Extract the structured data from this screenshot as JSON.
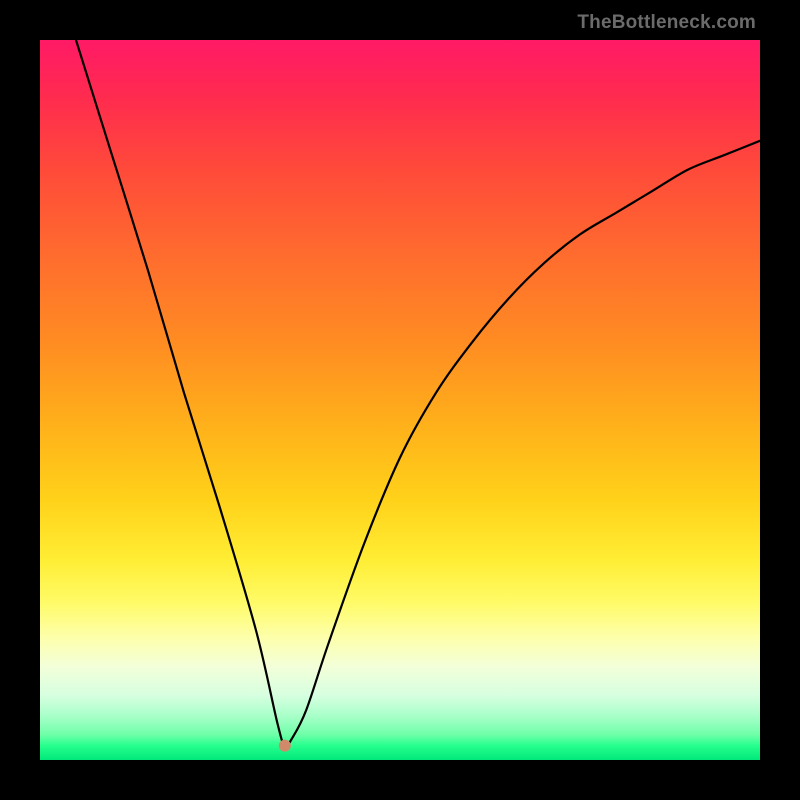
{
  "watermark": {
    "text": "TheBottleneck.com"
  },
  "chart_data": {
    "type": "line",
    "title": "",
    "xlabel": "",
    "ylabel": "",
    "xlim": [
      0,
      100
    ],
    "ylim": [
      0,
      100
    ],
    "grid": false,
    "legend": false,
    "annotations": [
      {
        "kind": "dot",
        "x": 34,
        "y": 2,
        "color": "#d08a6a"
      }
    ],
    "series": [
      {
        "name": "curve",
        "x": [
          5,
          10,
          15,
          20,
          25,
          30,
          33,
          34,
          35,
          37,
          40,
          45,
          50,
          55,
          60,
          65,
          70,
          75,
          80,
          85,
          90,
          95,
          100
        ],
        "values": [
          100,
          84,
          68,
          51,
          35,
          18,
          5,
          2,
          3,
          7,
          16,
          30,
          42,
          51,
          58,
          64,
          69,
          73,
          76,
          79,
          82,
          84,
          86
        ]
      }
    ],
    "background_gradient": {
      "orientation": "vertical",
      "colors_top_to_bottom": [
        "#ff1a66",
        "#ffd21a",
        "#00e87a"
      ]
    }
  }
}
